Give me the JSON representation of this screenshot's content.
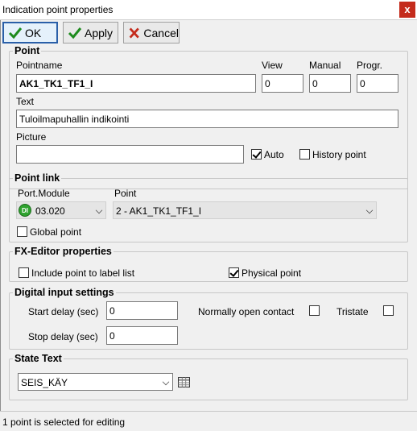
{
  "window": {
    "title": "Indication point properties",
    "close_glyph": "x"
  },
  "toolbar": {
    "ok_label": "OK",
    "apply_label": "Apply",
    "cancel_label": "Cancel"
  },
  "point_group": {
    "legend": "Point",
    "pointname_label": "Pointname",
    "pointname_value": "AK1_TK1_TF1_I",
    "view_label": "View",
    "view_value": "0",
    "manual_label": "Manual",
    "manual_value": "0",
    "progr_label": "Progr.",
    "progr_value": "0",
    "text_label": "Text",
    "text_value": "Tuloilmapuhallin indikointi",
    "picture_label": "Picture",
    "picture_value": "",
    "auto_label": "Auto",
    "auto_checked": true,
    "history_label": "History point",
    "history_checked": false
  },
  "point_link": {
    "legend": "Point link",
    "port_label": "Port.Module",
    "port_value": "03.020",
    "port_badge": "DI",
    "point_label": "Point",
    "point_value": "2 - AK1_TK1_TF1_I",
    "global_label": "Global point",
    "global_checked": false
  },
  "fx_editor": {
    "legend": "FX-Editor properties",
    "include_label": "Include point to label list",
    "include_checked": false,
    "physical_label": "Physical point",
    "physical_checked": true
  },
  "digital_input": {
    "legend": "Digital input settings",
    "start_label": "Start delay (sec)",
    "start_value": "0",
    "stop_label": "Stop delay (sec)",
    "stop_value": "0",
    "no_contact_label": "Normally open contact",
    "no_contact_checked": false,
    "tristate_label": "Tristate",
    "tristate_checked": false
  },
  "state_text": {
    "legend": "State Text",
    "value": "SEIS_KÄY"
  },
  "status_bar": {
    "text": "1 point is selected for editing"
  },
  "colors": {
    "accent": "#2a5fa8",
    "close": "#c42b1c",
    "di_badge": "#2fa32f",
    "dialog_bg": "#f0f0f0"
  }
}
